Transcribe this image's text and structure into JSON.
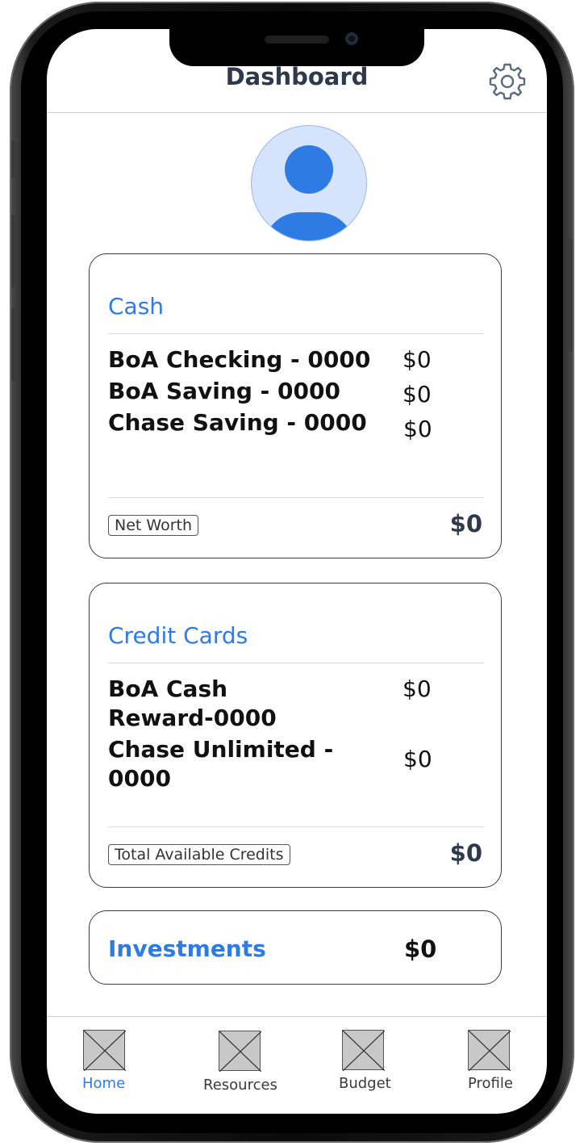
{
  "header": {
    "title": "Dashboard",
    "settings_icon": "gear-icon"
  },
  "avatar": {
    "icon": "user-avatar-icon"
  },
  "cash": {
    "title": "Cash",
    "accounts": [
      {
        "name": "BoA Checking - 0000",
        "amount": "$0"
      },
      {
        "name": "BoA Saving - 0000",
        "amount": "$0"
      },
      {
        "name": "Chase Saving - 0000",
        "amount": "$0"
      }
    ],
    "footer_label": "Net Worth",
    "footer_amount": "$0"
  },
  "credit_cards": {
    "title": "Credit Cards",
    "accounts": [
      {
        "name_line1": "BoA Cash",
        "name_line2": "Reward-0000",
        "amount": "$0"
      },
      {
        "name_line1": "Chase Unlimited -",
        "name_line2": "0000",
        "amount": "$0"
      }
    ],
    "footer_label": "Total Available Credits",
    "footer_amount": "$0"
  },
  "investments": {
    "title": "Investments",
    "amount": "$0"
  },
  "nav": {
    "items": [
      {
        "label": "Home",
        "active": true
      },
      {
        "label": "Resources",
        "active": false
      },
      {
        "label": "Budget",
        "active": false
      },
      {
        "label": "Profile",
        "active": false
      }
    ]
  },
  "colors": {
    "accent": "#2e7be4",
    "avatar_bg": "#d5e3fb",
    "heading": "#2e3a4c"
  }
}
